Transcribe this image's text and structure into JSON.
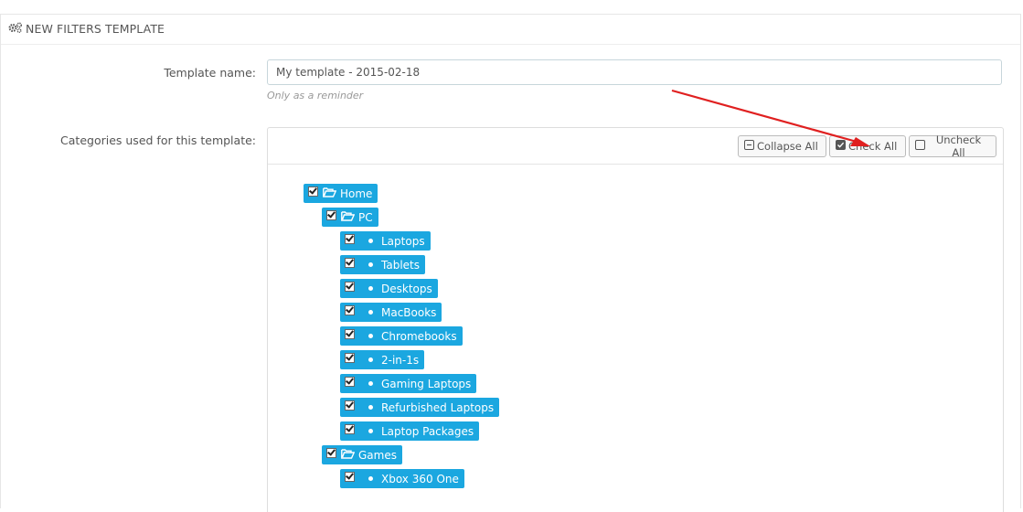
{
  "panel": {
    "title": "NEW FILTERS TEMPLATE",
    "icon": "cogs-icon"
  },
  "form": {
    "template_name_label": "Template name:",
    "template_name_value": "My template - 2015-02-18",
    "template_name_help": "Only as a reminder",
    "categories_label": "Categories used for this template:"
  },
  "tree_toolbar": {
    "collapse_all": "Collapse All",
    "check_all": "Check All",
    "uncheck_all": "Uncheck All"
  },
  "tree": {
    "nodes": [
      {
        "label": "Home",
        "type": "folder",
        "checked": true
      },
      {
        "label": "PC",
        "type": "folder",
        "checked": true
      },
      {
        "label": "Laptops",
        "type": "leaf",
        "checked": true
      },
      {
        "label": "Tablets",
        "type": "leaf",
        "checked": true
      },
      {
        "label": "Desktops",
        "type": "leaf",
        "checked": true
      },
      {
        "label": "MacBooks",
        "type": "leaf",
        "checked": true
      },
      {
        "label": "Chromebooks",
        "type": "leaf",
        "checked": true
      },
      {
        "label": "2-in-1s",
        "type": "leaf",
        "checked": true
      },
      {
        "label": "Gaming Laptops",
        "type": "leaf",
        "checked": true
      },
      {
        "label": "Refurbished Laptops",
        "type": "leaf",
        "checked": true
      },
      {
        "label": "Laptop Packages",
        "type": "leaf",
        "checked": true
      },
      {
        "label": "Games",
        "type": "folder",
        "checked": true
      },
      {
        "label": "Xbox 360 One",
        "type": "leaf",
        "checked": true
      }
    ]
  },
  "colors": {
    "node_bg": "#1ba7e0",
    "annotation_arrow": "#e02020"
  }
}
